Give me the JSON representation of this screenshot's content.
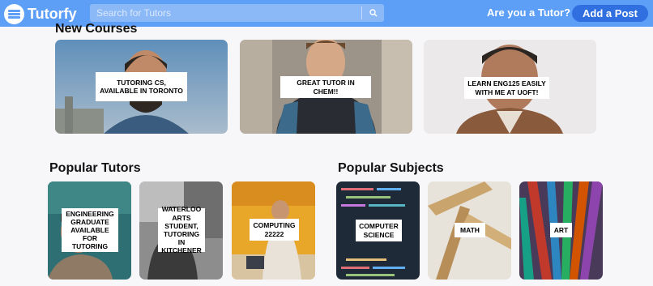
{
  "header": {
    "brand": "Tutorfy",
    "search_placeholder": "Search for Tutors",
    "tutor_prompt": "Are you a Tutor?",
    "add_post_label": "Add a Post"
  },
  "sections": {
    "new_courses": {
      "title": "New Courses",
      "cards": [
        {
          "label": "TUTORING CS, AVAILABLE IN TORONTO"
        },
        {
          "label": "GREAT TUTOR IN CHEM!!"
        },
        {
          "label": "LEARN ENG125 EASILY WITH ME AT UOFT!"
        }
      ]
    },
    "popular_tutors": {
      "title": "Popular Tutors",
      "cards": [
        {
          "label": "ENGINEERING GRADUATE AVAILABLE FOR TUTORING"
        },
        {
          "label": "WATERLOO ARTS STUDENT, TUTORING IN KITCHENER"
        },
        {
          "label": "COMPUTING 22222"
        }
      ]
    },
    "popular_subjects": {
      "title": "Popular Subjects",
      "cards": [
        {
          "label": "COMPUTER SCIENCE"
        },
        {
          "label": "MATH"
        },
        {
          "label": "ART"
        }
      ]
    }
  },
  "colors": {
    "navbar": "#5d9ff7",
    "add_post_button": "#2f6fe0",
    "page_background": "#f7f7f9"
  }
}
